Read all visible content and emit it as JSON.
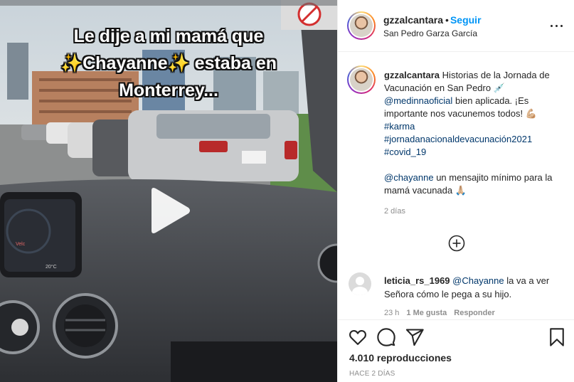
{
  "video": {
    "caption_lines": [
      "Le dije a mi mamá que",
      "✨Chayanne✨ estaba en",
      "Monterrey..."
    ],
    "dashboard_label": "Velc",
    "dashboard_temp": "20°C"
  },
  "header": {
    "username": "gzzalcantara",
    "separator": "•",
    "follow_label": "Seguir",
    "location": "San Pedro Garza García"
  },
  "post": {
    "username": "gzzalcantara",
    "caption_text_1": "Historias de la Jornada de Vacunación en San Pedro 💉",
    "mention_1": "@medinnaoficial",
    "caption_text_2": "bien aplicada. ¡Es importante nos vacunemos todos! 💪🏼",
    "hashtags": [
      "#karma",
      "#jornadanacionaldevacunación2021",
      "#covid_19"
    ],
    "mention_2": "@chayanne",
    "caption_text_3": "un mensajito mínimo para la mamá vacunada 🙏🏼",
    "age": "2 días"
  },
  "comment": {
    "username": "leticia_rs_1969",
    "mention": "@Chayanne",
    "text": "la va a ver Señora cómo le pega a su hijo.",
    "age": "23 h",
    "likes": "1 Me gusta",
    "reply": "Responder"
  },
  "actions": {
    "views": "4.010 reproducciones",
    "posted_ago": "HACE 2 DÍAS"
  }
}
